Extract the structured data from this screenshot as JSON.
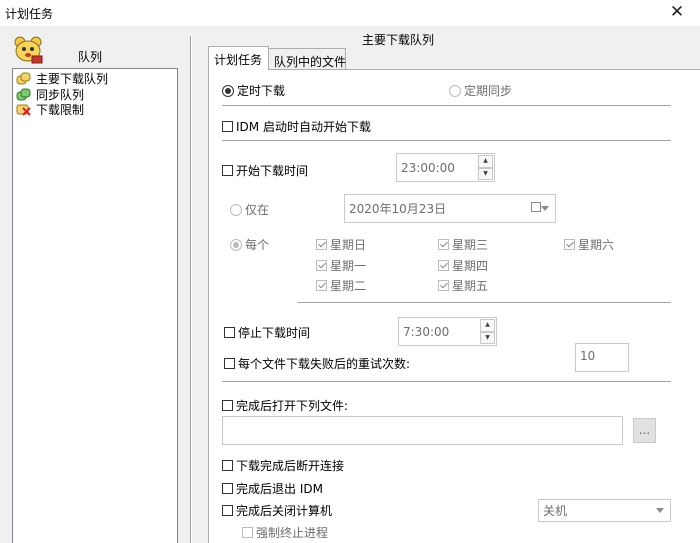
{
  "window": {
    "title": "计划任务",
    "close_glyph": "✕"
  },
  "left_panel": {
    "heading": "队列",
    "items": [
      {
        "label": "主要下载队列",
        "icon": "queue-icon"
      },
      {
        "label": "同步队列",
        "icon": "sync-queue-icon"
      },
      {
        "label": "下载限制",
        "icon": "limit-icon"
      }
    ]
  },
  "main": {
    "heading": "主要下载队列",
    "tabs": [
      {
        "label": "计划任务"
      },
      {
        "label": "队列中的文件"
      }
    ],
    "mode": {
      "one_time_label": "定时下载",
      "sync_label": "定期同步"
    },
    "idm_start_label": "IDM 启动时自动开始下载",
    "start_time": {
      "label": "开始下载时间",
      "value": "23:00:00"
    },
    "once": {
      "label": "仅在",
      "date": "2020年10月23日"
    },
    "daily": {
      "label": "每个",
      "days": [
        "星期日",
        "星期一",
        "星期二",
        "星期三",
        "星期四",
        "星期五",
        "星期六"
      ]
    },
    "stop_time": {
      "label": "停止下载时间",
      "value": "7:30:00"
    },
    "retry": {
      "label": "每个文件下载失败后的重试次数:",
      "value": "10"
    },
    "open_file": {
      "label": "完成后打开下列文件:",
      "browse": "..."
    },
    "disconnect_label": "下载完成后断开连接",
    "exit_idm_label": "完成后退出 IDM",
    "shutdown": {
      "label": "完成后关闭计算机",
      "option": "关机"
    },
    "force_kill_label": "强制终止进程"
  },
  "colors": {
    "window_bg": "#f0f0f0",
    "panel_bg": "#ffffff",
    "disabled_text": "#6d6d6d"
  }
}
